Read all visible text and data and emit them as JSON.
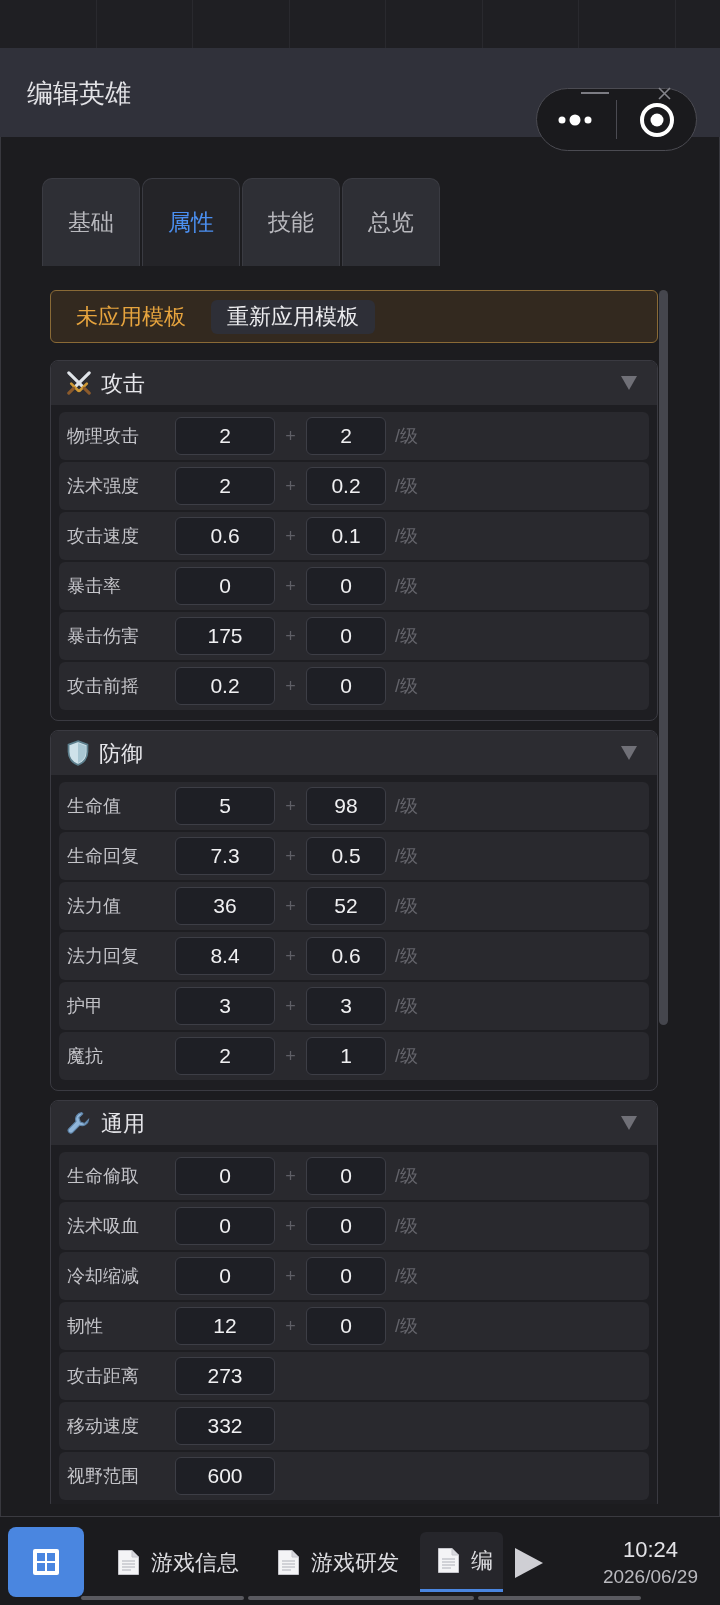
{
  "window": {
    "title": "编辑英雄"
  },
  "tabs": [
    {
      "label": "基础",
      "selected": false
    },
    {
      "label": "属性",
      "selected": true
    },
    {
      "label": "技能",
      "selected": false
    },
    {
      "label": "总览",
      "selected": false
    }
  ],
  "template_banner": {
    "status": "未应用模板",
    "button": "重新应用模板"
  },
  "sections": [
    {
      "title": "攻击",
      "expanded": true,
      "rows": [
        {
          "label": "物理攻击",
          "base": "2",
          "plus": "+",
          "growth": "2",
          "unit": "/级"
        },
        {
          "label": "法术强度",
          "base": "2",
          "plus": "+",
          "growth": "0.2",
          "unit": "/级"
        },
        {
          "label": "攻击速度",
          "base": "0.6",
          "plus": "+",
          "growth": "0.1",
          "unit": "/级"
        },
        {
          "label": "暴击率",
          "base": "0",
          "plus": "+",
          "growth": "0",
          "unit": "/级"
        },
        {
          "label": "暴击伤害",
          "base": "175",
          "plus": "+",
          "growth": "0",
          "unit": "/级"
        },
        {
          "label": "攻击前摇",
          "base": "0.2",
          "plus": "+",
          "growth": "0",
          "unit": "/级"
        }
      ]
    },
    {
      "title": "防御",
      "expanded": true,
      "rows": [
        {
          "label": "生命值",
          "base": "5",
          "plus": "+",
          "growth": "98",
          "unit": "/级"
        },
        {
          "label": "生命回复",
          "base": "7.3",
          "plus": "+",
          "growth": "0.5",
          "unit": "/级"
        },
        {
          "label": "法力值",
          "base": "36",
          "plus": "+",
          "growth": "52",
          "unit": "/级"
        },
        {
          "label": "法力回复",
          "base": "8.4",
          "plus": "+",
          "growth": "0.6",
          "unit": "/级"
        },
        {
          "label": "护甲",
          "base": "3",
          "plus": "+",
          "growth": "3",
          "unit": "/级"
        },
        {
          "label": "魔抗",
          "base": "2",
          "plus": "+",
          "growth": "1",
          "unit": "/级"
        }
      ]
    },
    {
      "title": "通用",
      "expanded": true,
      "rows": [
        {
          "label": "生命偷取",
          "base": "0",
          "plus": "+",
          "growth": "0",
          "unit": "/级"
        },
        {
          "label": "法术吸血",
          "base": "0",
          "plus": "+",
          "growth": "0",
          "unit": "/级"
        },
        {
          "label": "冷却缩减",
          "base": "0",
          "plus": "+",
          "growth": "0",
          "unit": "/级"
        },
        {
          "label": "韧性",
          "base": "12",
          "plus": "+",
          "growth": "0",
          "unit": "/级"
        },
        {
          "label": "攻击距离",
          "base": "273"
        },
        {
          "label": "移动速度",
          "base": "332"
        },
        {
          "label": "视野范围",
          "base": "600"
        }
      ]
    }
  ],
  "taskbar": {
    "tasks": [
      {
        "label": "游戏信息",
        "selected": false
      },
      {
        "label": "游戏研发",
        "selected": false
      },
      {
        "label": "编",
        "selected": true
      }
    ],
    "clock": {
      "time": "10:24",
      "date": "2026/06/29"
    }
  }
}
